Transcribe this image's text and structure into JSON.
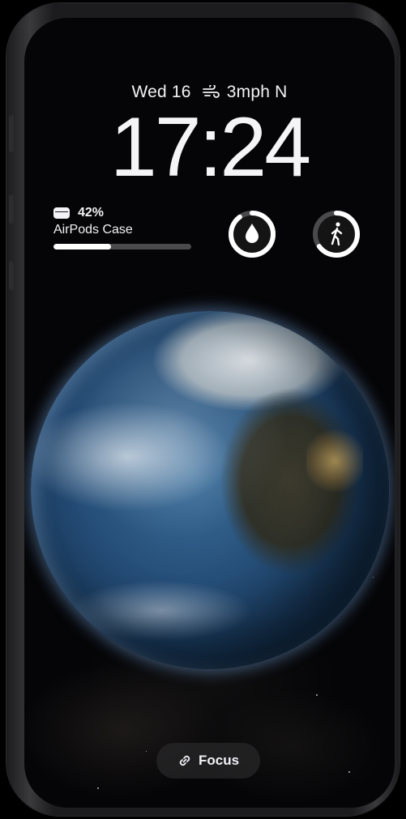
{
  "lockscreen": {
    "date": "Wed 16",
    "weather": "3mph N",
    "time": "17:24"
  },
  "battery_widget": {
    "percent_label": "42%",
    "percent_value": 42,
    "device": "AirPods Case"
  },
  "rings": {
    "water": {
      "icon": "water-drop-icon",
      "fill": 0.9
    },
    "activity": {
      "icon": "walking-figure-icon",
      "fill": 0.65
    }
  },
  "focus": {
    "label": "Focus",
    "icon": "link-icon"
  },
  "colors": {
    "text": "#f2f2f7",
    "ring_track": "#4a4a4c",
    "ring_fill": "#ffffff"
  }
}
